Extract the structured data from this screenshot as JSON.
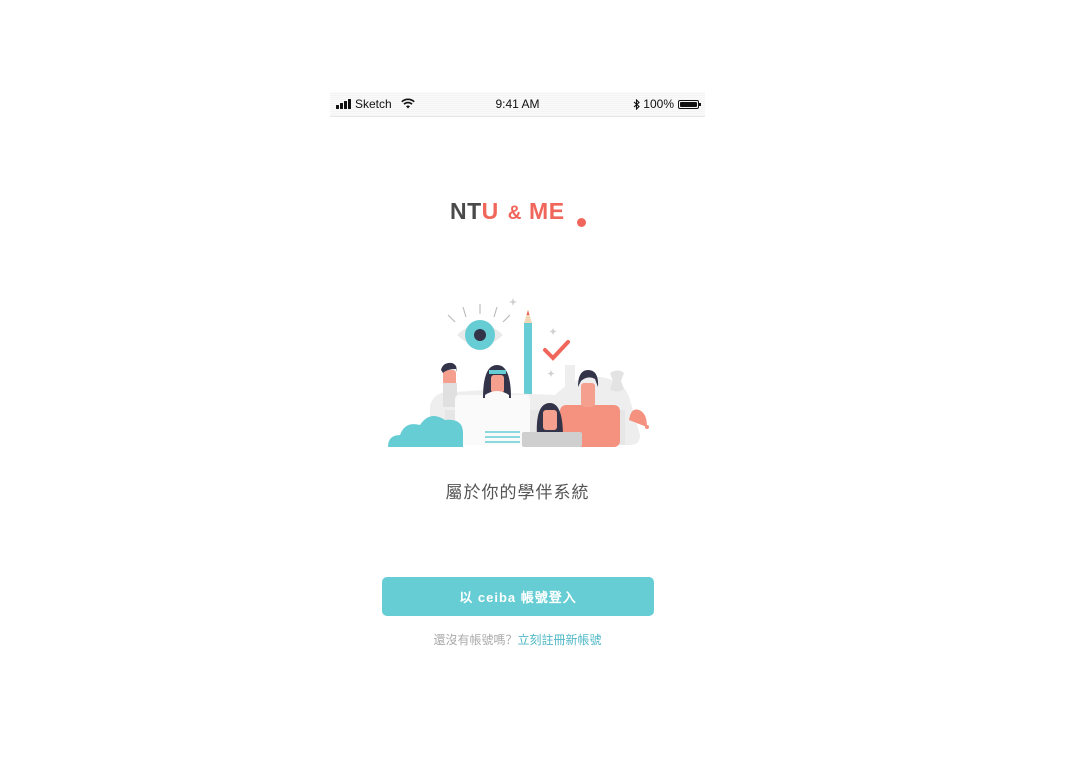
{
  "status_bar": {
    "carrier": "Sketch",
    "time": "9:41 AM",
    "battery": "100%"
  },
  "logo": {
    "part_nt": "NT",
    "part_u": "U",
    "part_amp": "&",
    "part_me": "ME"
  },
  "tagline": "屬於你的學伴系統",
  "login_button": "以 ceiba 帳號登入",
  "signup": {
    "question": "還沒有帳號嗎？",
    "link": "立刻註冊新帳號"
  },
  "colors": {
    "accent": "#66cdd4",
    "brand_red": "#f0665a",
    "link": "#4fb8c6"
  }
}
